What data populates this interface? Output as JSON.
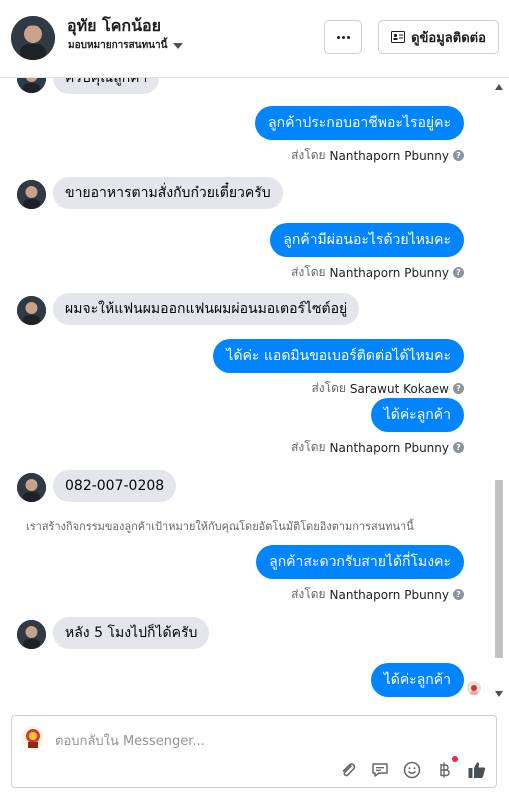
{
  "header": {
    "name": "อุทัย โคกน้อย",
    "assignment": "มอบหมายการสนทนานี้",
    "more_label": "...",
    "contact_label": "ดูข้อมูลติดต่อ"
  },
  "messages": {
    "partial_incoming": "ครับคุณลูกค้า",
    "out_1": "ลูกค้าประกอบอาชีพอะไรอยู่คะ",
    "sent_by_1_prefix": "ส่งโดย",
    "sent_by_1_name": "Nanthaporn Pbunny",
    "in_1": "ขายอาหารตามสั่งกับก๋วยเตี๋ยวครับ",
    "out_2": "ลูกค้ามีผ่อนอะไรด้วยไหมคะ",
    "sent_by_2_prefix": "ส่งโดย",
    "sent_by_2_name": "Nanthaporn Pbunny",
    "in_2": "ผมจะให้แฟนผมออกแฟนผมผ่อนมอเตอร์ไซต์อยู่",
    "out_3": "ได้ค่ะ แอดมินขอเบอร์ติดต่อได้ไหมคะ",
    "sent_by_3_prefix": "ส่งโดย",
    "sent_by_3_name": "Sarawut Kokaew",
    "out_4": "ได้ค่ะลูกค้า",
    "sent_by_4_prefix": "ส่งโดย",
    "sent_by_4_name": "Nanthaporn Pbunny",
    "in_3": "082-007-0208",
    "system_note": "เราสร้างกิจกรรมของลูกค้าเป้าหมายให้กับคุณโดยอัตโนมัติโดยอิงตามการสนทนานี้",
    "out_5": "ลูกค้าสะดวกรับสายได้กี่โมงคะ",
    "sent_by_5_prefix": "ส่งโดย",
    "sent_by_5_name": "Nanthaporn Pbunny",
    "in_4": "หลัง 5 โมงไปก็ได้ครับ",
    "out_6": "ได้ค่ะลูกค้า",
    "info_glyph": "?"
  },
  "composer": {
    "placeholder": "ตอบกลับใน Messenger..."
  },
  "colors": {
    "outgoing_bubble": "#0084ff",
    "incoming_bubble": "#e4e6eb",
    "notification_badge": "#f02849"
  },
  "icons": [
    "paperclip-icon",
    "chat-bubble-icon",
    "emoji-icon",
    "baht-payment-icon",
    "like-icon",
    "info-icon",
    "chevron-down-icon",
    "more-icon",
    "contact-card-icon"
  ]
}
